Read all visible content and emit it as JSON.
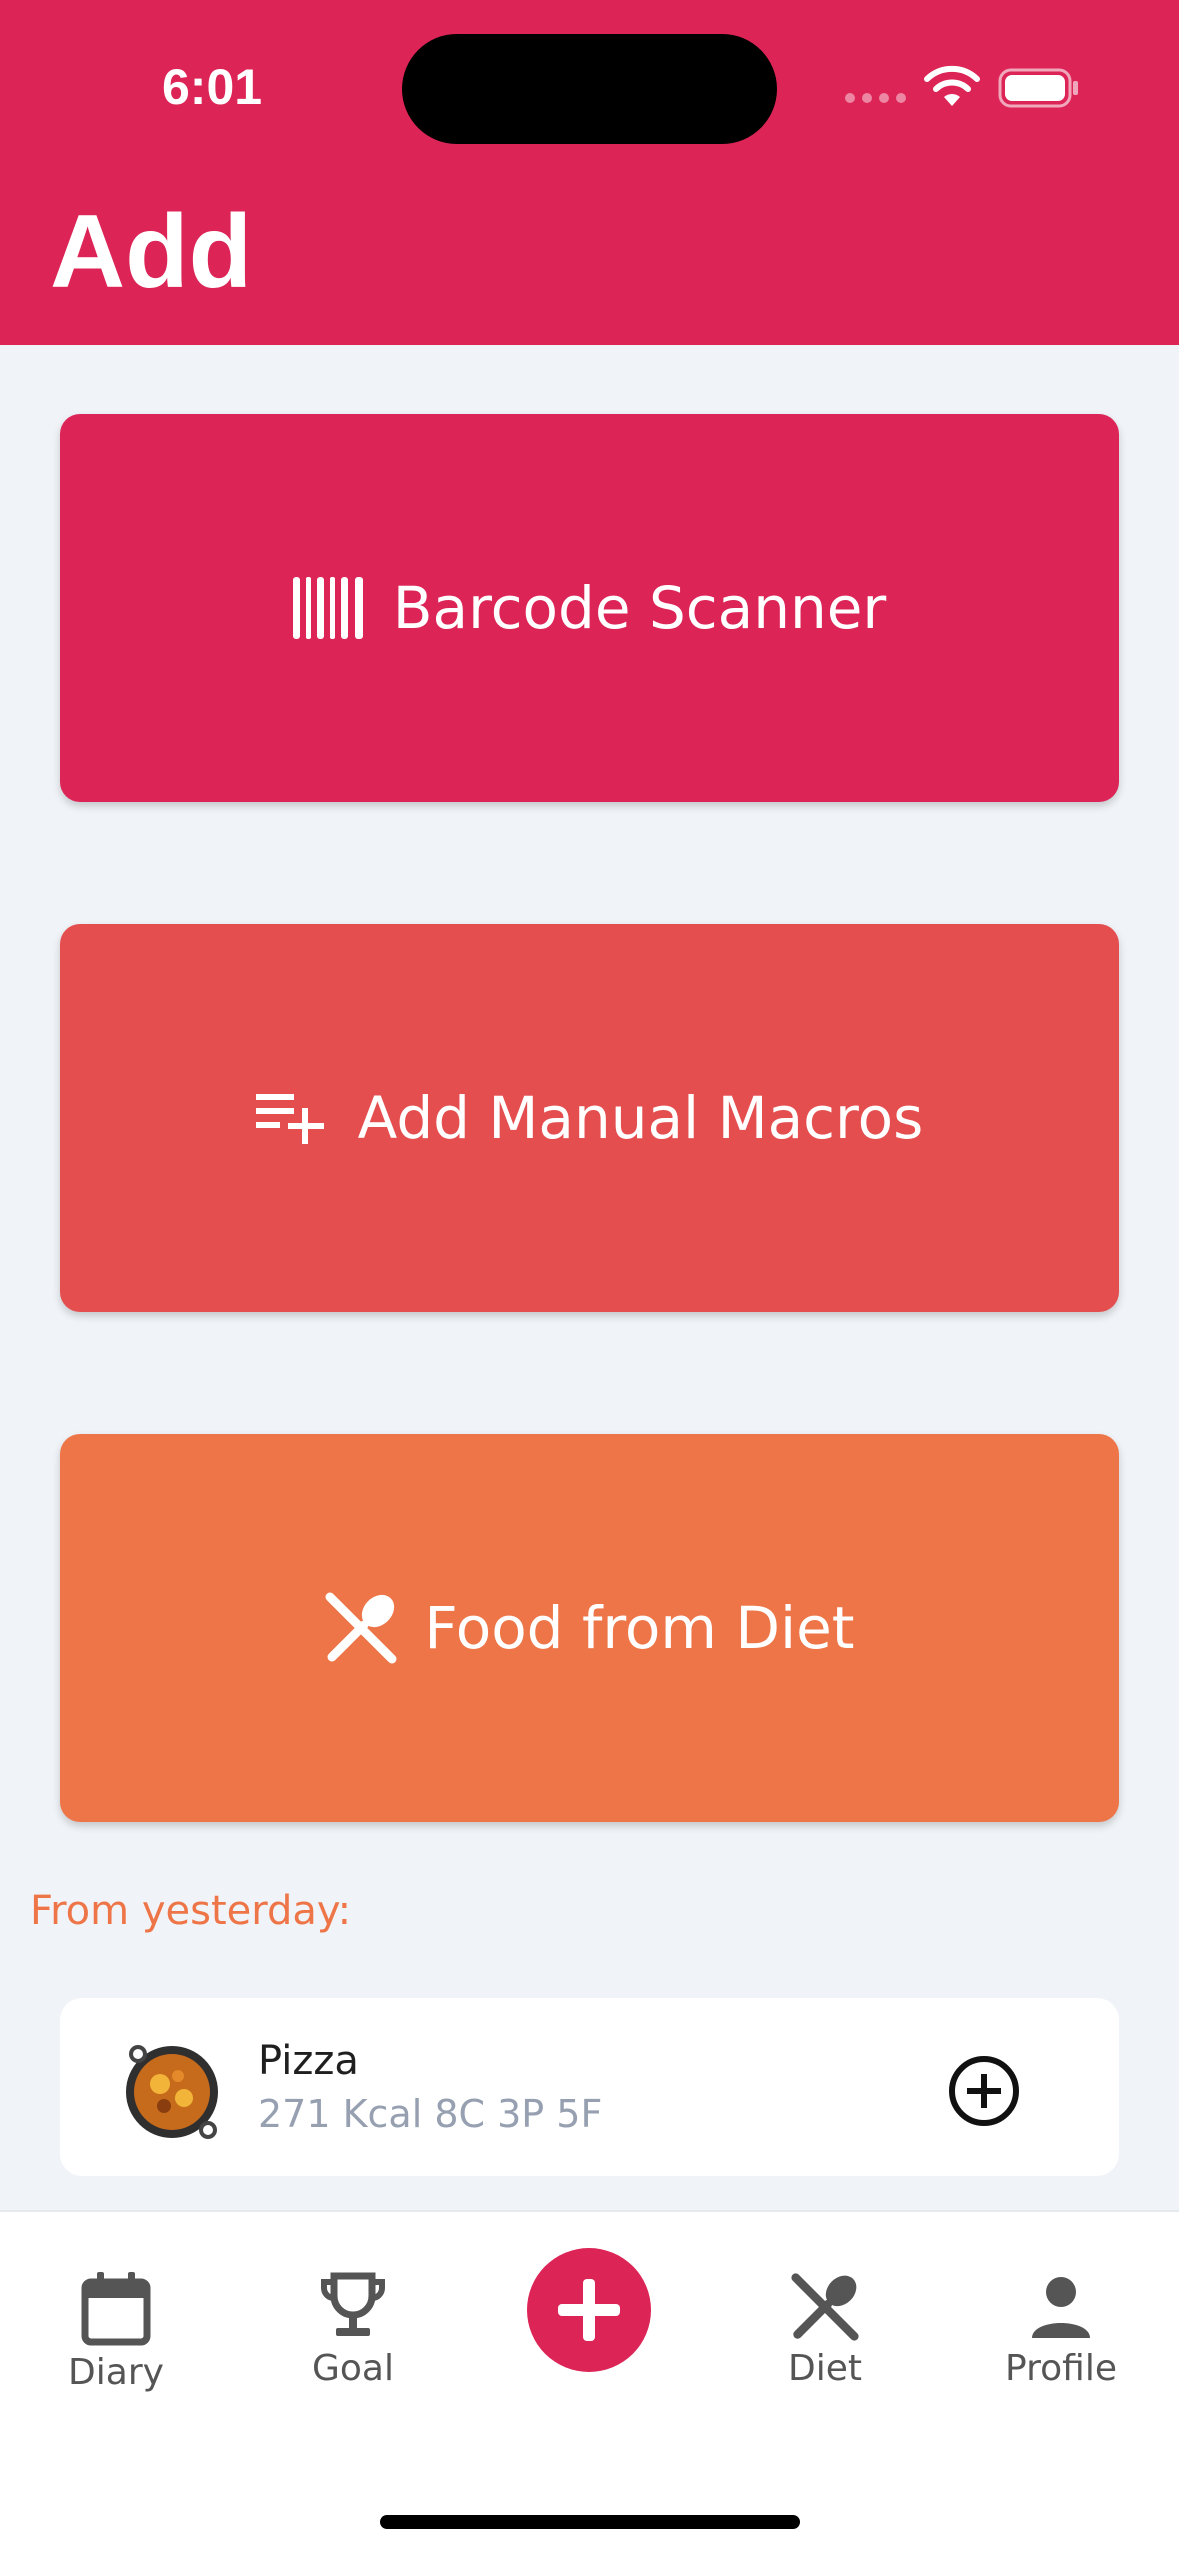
{
  "status_bar": {
    "time": "6:01"
  },
  "header": {
    "title": "Add"
  },
  "actions": [
    {
      "label": "Barcode Scanner",
      "icon": "barcode-icon",
      "color": "#DC2456"
    },
    {
      "label": "Add Manual Macros",
      "icon": "playlist-add-icon",
      "color": "#E54E4F"
    },
    {
      "label": "Food from Diet",
      "icon": "utensils-icon",
      "color": "#EE7547"
    }
  ],
  "recent": {
    "heading": "From yesterday:",
    "items": [
      {
        "name": "Pizza",
        "macros": "271 Kcal 8C 3P 5F",
        "icon": "food-pan-icon"
      }
    ]
  },
  "tabbar": {
    "tabs": [
      {
        "label": "Diary",
        "icon": "calendar-icon"
      },
      {
        "label": "Goal",
        "icon": "trophy-icon"
      },
      {
        "label": "Diet",
        "icon": "utensils-icon"
      },
      {
        "label": "Profile",
        "icon": "person-icon"
      }
    ],
    "center_button_icon": "plus-icon"
  },
  "colors": {
    "brand": "#DC2456",
    "coral": "#E54E4F",
    "orange": "#EE7547",
    "background": "#F0F3F7",
    "muted_text": "#96A0B1"
  }
}
